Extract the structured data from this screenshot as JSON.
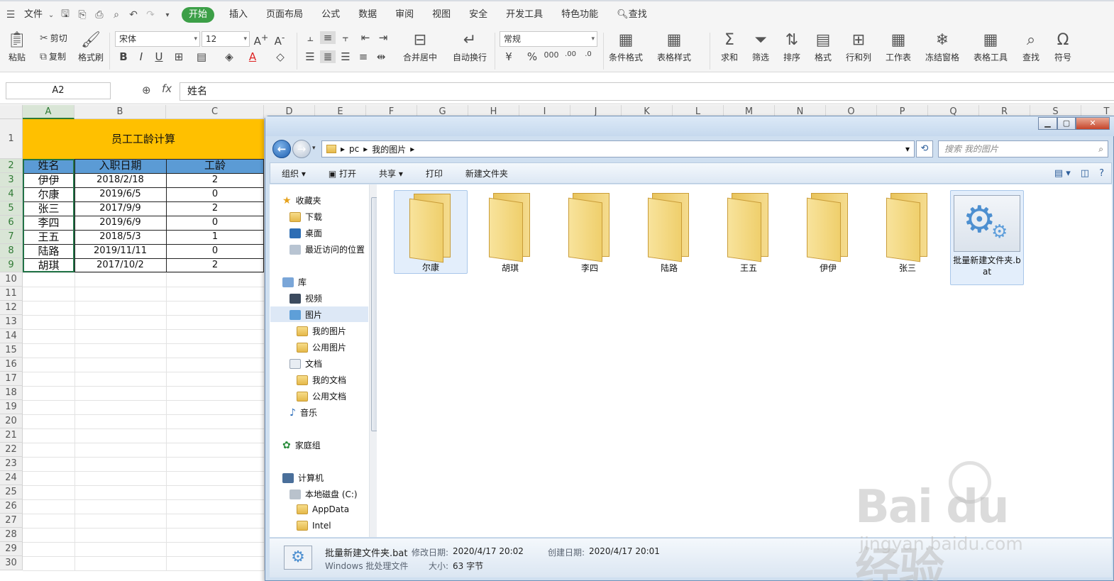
{
  "menu": {
    "file": "文件",
    "tabs": [
      "开始",
      "插入",
      "页面布局",
      "公式",
      "数据",
      "审阅",
      "视图",
      "安全",
      "开发工具",
      "特色功能"
    ],
    "active_tab": "开始",
    "search": "查找"
  },
  "ribbon": {
    "paste": "粘贴",
    "cut": "剪切",
    "copy": "复制",
    "format_painter": "格式刷",
    "font_name": "宋体",
    "font_size": "12",
    "merge_center": "合并居中",
    "wrap_text": "自动换行",
    "number_format": "常规",
    "conditional_format": "条件格式",
    "table_style": "表格样式",
    "sum": "求和",
    "filter": "筛选",
    "sort": "排序",
    "format": "格式",
    "row_col": "行和列",
    "worksheet": "工作表",
    "freeze": "冻结窗格",
    "table_tools": "表格工具",
    "find": "查找",
    "symbol": "符号"
  },
  "formula_bar": {
    "name_box": "A2",
    "fx": "fx",
    "content": "姓名"
  },
  "sheet": {
    "columns": [
      "A",
      "B",
      "C",
      "D",
      "E",
      "F",
      "G",
      "H",
      "I",
      "J",
      "K",
      "L",
      "M",
      "N",
      "O",
      "P",
      "Q",
      "R",
      "S",
      "T"
    ],
    "rows": [
      "1",
      "2",
      "3",
      "4",
      "5",
      "6",
      "7",
      "8",
      "9",
      "10",
      "11",
      "12",
      "13",
      "14",
      "15",
      "16",
      "17",
      "18",
      "19",
      "20",
      "21",
      "22",
      "23",
      "24",
      "25",
      "26",
      "27",
      "28",
      "29",
      "30"
    ],
    "title": "员工工龄计算",
    "headers": [
      "姓名",
      "入职日期",
      "工龄"
    ],
    "data": [
      [
        "伊伊",
        "2018/2/18",
        "2"
      ],
      [
        "尔康",
        "2019/6/5",
        "0"
      ],
      [
        "张三",
        "2017/9/9",
        "2"
      ],
      [
        "李四",
        "2019/6/9",
        "0"
      ],
      [
        "王五",
        "2018/5/3",
        "1"
      ],
      [
        "陆路",
        "2019/11/11",
        "0"
      ],
      [
        "胡琪",
        "2017/10/2",
        "2"
      ]
    ],
    "colors": {
      "title_bg": "#ffc000",
      "header_bg": "#5b9bd5",
      "selection": "#217346"
    }
  },
  "explorer": {
    "address": [
      "pc",
      "我的图片"
    ],
    "search_placeholder": "搜索 我的图片",
    "toolbar": [
      "组织 ▾",
      "打开",
      "共享 ▾",
      "打印",
      "新建文件夹"
    ],
    "nav": {
      "favorites": "收藏夹",
      "downloads": "下载",
      "desktop": "桌面",
      "recent": "最近访问的位置",
      "libraries": "库",
      "videos": "视频",
      "pictures": "图片",
      "my_pictures": "我的图片",
      "public_pictures": "公用图片",
      "documents": "文档",
      "my_documents": "我的文档",
      "public_documents": "公用文档",
      "music": "音乐",
      "homegroup": "家庭组",
      "computer": "计算机",
      "local_disk": "本地磁盘 (C:)",
      "appdata": "AppData",
      "intel": "Intel"
    },
    "items": [
      "尔康",
      "胡琪",
      "李四",
      "陆路",
      "王五",
      "伊伊",
      "张三"
    ],
    "bat_item": "批量新建文件夹.bat",
    "status": {
      "filename": "批量新建文件夹.bat",
      "modified_label": "修改日期:",
      "modified": "2020/4/17 20:02",
      "created_label": "创建日期:",
      "created": "2020/4/17 20:01",
      "type": "Windows 批处理文件",
      "size_label": "大小:",
      "size": "63 字节"
    }
  },
  "watermark": {
    "brand": "Bai  du 经验",
    "url": "jingyan.baidu.com"
  }
}
